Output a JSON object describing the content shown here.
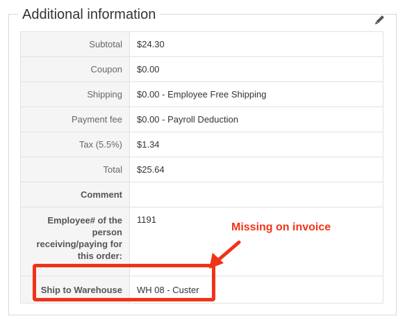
{
  "section": {
    "title": "Additional information",
    "edit_icon": "pencil-icon"
  },
  "rows": [
    {
      "label": "Subtotal",
      "value": "$24.30"
    },
    {
      "label": "Coupon",
      "value": "$0.00"
    },
    {
      "label": "Shipping",
      "value": "$0.00 - Employee Free Shipping"
    },
    {
      "label": "Payment fee",
      "value": "$0.00 - Payroll Deduction"
    },
    {
      "label": "Tax (5.5%)",
      "value": "$1.34"
    },
    {
      "label": "Total",
      "value": "$25.64"
    },
    {
      "label": "Comment",
      "value": ""
    },
    {
      "label": "Employee# of the person receiving/paying for this order:",
      "value": "1191"
    },
    {
      "label": "Ship to Warehouse",
      "value": "WH 08 - Custer"
    }
  ],
  "annotation": {
    "text": "Missing on invoice",
    "color": "#f03317"
  }
}
